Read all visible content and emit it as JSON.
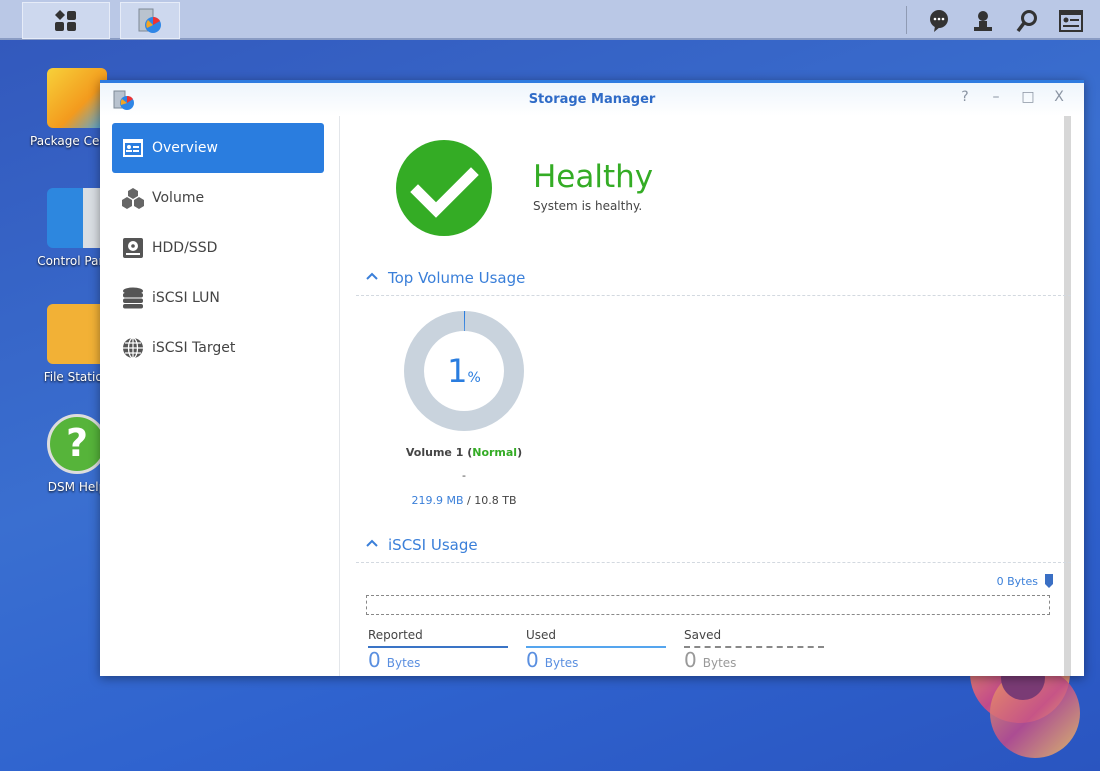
{
  "taskbar": {
    "main_menu": "main-menu",
    "app": "storage-manager"
  },
  "desktop": {
    "icons": [
      {
        "label": "Package Center"
      },
      {
        "label": "Control Panel"
      },
      {
        "label": "File Station"
      },
      {
        "label": "DSM Help"
      }
    ]
  },
  "window": {
    "title": "Storage Manager",
    "controls": [
      "?",
      "–",
      "□",
      "X"
    ]
  },
  "sidebar": {
    "items": [
      {
        "label": "Overview",
        "icon": "overview-icon"
      },
      {
        "label": "Volume",
        "icon": "cubes-icon"
      },
      {
        "label": "HDD/SSD",
        "icon": "disk-icon"
      },
      {
        "label": "iSCSI LUN",
        "icon": "database-icon"
      },
      {
        "label": "iSCSI Target",
        "icon": "globe-icon"
      }
    ]
  },
  "health": {
    "status": "Healthy",
    "message": "System is healthy.",
    "color": "#34ac25"
  },
  "top_volume": {
    "heading": "Top Volume Usage",
    "percent_value": "1",
    "percent_sign": "%",
    "usage_fraction": 0.01,
    "volume_name": "Volume 1 (",
    "volume_status": "Normal",
    "close_paren": ")",
    "dash": "-",
    "used": "219.9 MB",
    "total": " / 10.8 TB"
  },
  "iscsi": {
    "heading": "iSCSI Usage",
    "bar_label": "0 Bytes",
    "stats": [
      {
        "label": "Reported",
        "value": "0",
        "unit": "Bytes"
      },
      {
        "label": "Used",
        "value": "0",
        "unit": "Bytes"
      },
      {
        "label": "Saved",
        "value": "0",
        "unit": "Bytes"
      }
    ]
  }
}
